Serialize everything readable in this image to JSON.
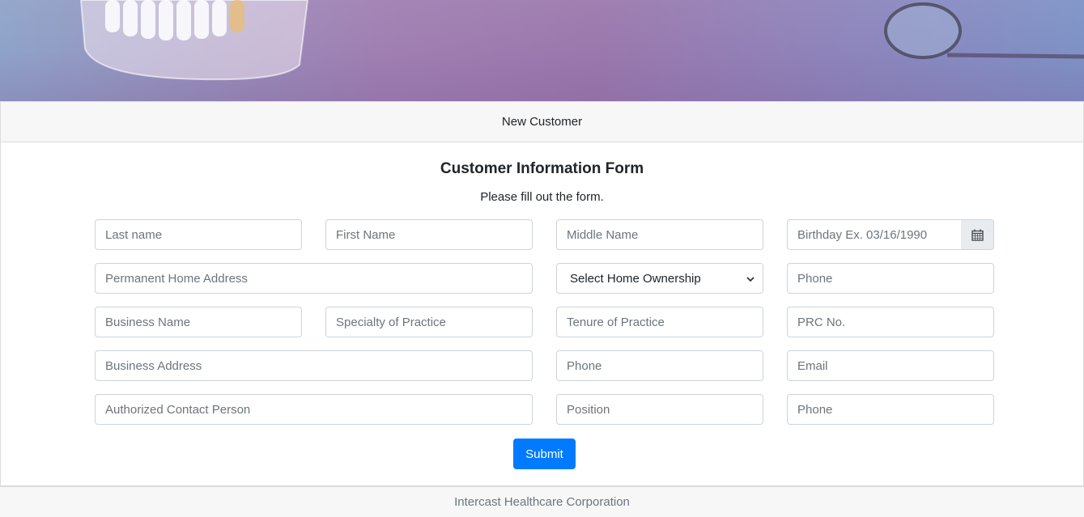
{
  "header": {
    "title": "New Customer"
  },
  "form": {
    "title": "Customer Information Form",
    "subtitle": "Please fill out the form.",
    "last_name": {
      "placeholder": "Last name",
      "value": ""
    },
    "first_name": {
      "placeholder": "First Name",
      "value": ""
    },
    "middle_name": {
      "placeholder": "Middle Name",
      "value": ""
    },
    "birthday": {
      "placeholder": "Birthday Ex. 03/16/1990",
      "value": ""
    },
    "home_address": {
      "placeholder": "Permanent Home Address",
      "value": ""
    },
    "home_ownership": {
      "selected": "Select Home Ownership"
    },
    "home_phone": {
      "placeholder": "Phone",
      "value": ""
    },
    "business_name": {
      "placeholder": "Business Name",
      "value": ""
    },
    "specialty": {
      "placeholder": "Specialty of Practice",
      "value": ""
    },
    "tenure": {
      "placeholder": "Tenure of Practice",
      "value": ""
    },
    "prc_no": {
      "placeholder": "PRC No.",
      "value": ""
    },
    "business_address": {
      "placeholder": "Business Address",
      "value": ""
    },
    "business_phone": {
      "placeholder": "Phone",
      "value": ""
    },
    "email": {
      "placeholder": "Email",
      "value": ""
    },
    "contact_person": {
      "placeholder": "Authorized Contact Person",
      "value": ""
    },
    "position": {
      "placeholder": "Position",
      "value": ""
    },
    "contact_phone": {
      "placeholder": "Phone",
      "value": ""
    },
    "submit_label": "Submit"
  },
  "footer": {
    "text": "Intercast Healthcare Corporation"
  },
  "colors": {
    "primary": "#007bff",
    "header_bg": "#f7f7f7",
    "border": "#ced4da"
  },
  "icons": {
    "birthday_addon": "calendar-icon",
    "select_caret": "chevron-down-icon"
  }
}
